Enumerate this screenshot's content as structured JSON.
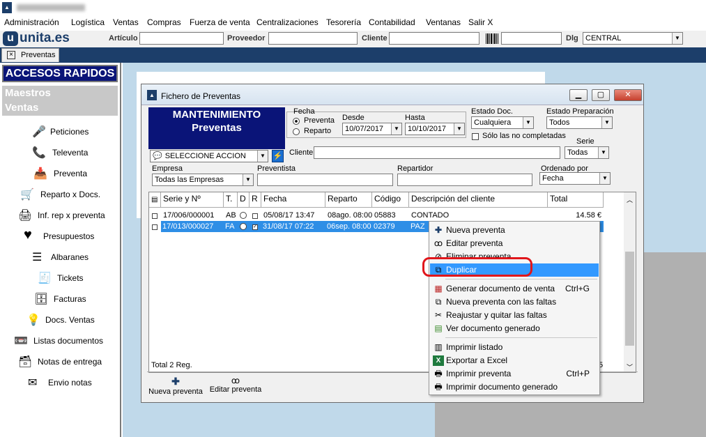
{
  "menu": [
    "Administración",
    "Logística",
    "Ventas",
    "Compras",
    "Fuerza de venta",
    "Centralizaciones",
    "Tesorería",
    "Contabilidad",
    "Ventanas",
    "Salir X"
  ],
  "logo": "unita.es",
  "toolbar": {
    "articulo": "Artículo",
    "proveedor": "Proveedor",
    "cliente": "Cliente",
    "dlg": "Dlg",
    "dlg_value": "CENTRAL"
  },
  "tab": "Preventas",
  "sidebar": {
    "title": "ACCESOS RAPIDOS",
    "maestros": "Maestros",
    "ventas": "Ventas",
    "items": [
      "Peticiones",
      "Televenta",
      "Preventa",
      "Reparto x Docs.",
      "Inf. rep x preventa",
      "Presupuestos",
      "Albaranes",
      "Tickets",
      "Facturas",
      "Docs. Ventas",
      "Listas documentos",
      "Notas de entrega",
      "Envio notas"
    ]
  },
  "window": {
    "title": "Fichero de Preventas",
    "heading1": "MANTENIMIENTO",
    "heading2": "Preventas",
    "fecha": "Fecha",
    "radio1": "Preventa",
    "radio2": "Reparto",
    "desde": "Desde",
    "desde_val": "10/07/2017",
    "hasta": "Hasta",
    "hasta_val": "10/10/2017",
    "estado_doc": "Estado Doc.",
    "estado_doc_val": "Cualquiera",
    "estado_prep": "Estado Preparación",
    "estado_prep_val": "Todos",
    "solo": "Sólo las no completadas",
    "serie": "Serie",
    "serie_val": "Todas",
    "accion": "SELECCIONE ACCION",
    "cliente": "Cliente",
    "empresa": "Empresa",
    "empresa_val": "Todas las Empresas",
    "preventista": "Preventista",
    "repartidor": "Repartidor",
    "ordenado": "Ordenado por",
    "ordenado_val": "Fecha",
    "total_reg": "Total 2 Reg.",
    "total_frag": "5",
    "btn_nueva": "Nueva preventa",
    "btn_editar": "Editar preventa"
  },
  "grid": {
    "headers": [
      "Serie y Nº",
      "T.",
      "D",
      "R",
      "Fecha",
      "Reparto",
      "Código",
      "Descripción del cliente",
      "Total"
    ],
    "rows": [
      {
        "serie": "17/006/000001",
        "t": "AB",
        "fecha": "05/08/17 13:47",
        "reparto": "08ago. 08:00",
        "codigo": "05883",
        "desc": "CONTADO",
        "total": "14.58 €"
      },
      {
        "serie": "17/013/000027",
        "t": "FA",
        "fecha": "31/08/17 07:22",
        "reparto": "06sep. 08:00",
        "codigo": "02379",
        "desc": "PAZ",
        "total": ""
      }
    ]
  },
  "context_menu": [
    {
      "label": "Nueva preventa",
      "shortcut": "",
      "icon": "plus-icon"
    },
    {
      "label": "Editar preventa",
      "shortcut": "",
      "icon": "glasses-icon"
    },
    {
      "label": "Eliminar preventa",
      "shortcut": "",
      "icon": "delete-icon"
    },
    {
      "label": "Duplicar",
      "shortcut": "",
      "icon": "duplicate-icon"
    },
    {
      "label": "Generar documento de venta",
      "shortcut": "Ctrl+G",
      "icon": "generate-doc-icon"
    },
    {
      "label": "Nueva preventa con las faltas",
      "shortcut": "",
      "icon": "new-missing-icon"
    },
    {
      "label": "Reajustar y quitar las faltas",
      "shortcut": "",
      "icon": "scissors-icon"
    },
    {
      "label": "Ver documento generado",
      "shortcut": "",
      "icon": "view-doc-icon"
    },
    {
      "label": "Imprimir listado",
      "shortcut": "",
      "icon": "print-list-icon"
    },
    {
      "label": "Exportar a Excel",
      "shortcut": "",
      "icon": "excel-icon"
    },
    {
      "label": "Imprimir preventa",
      "shortcut": "Ctrl+P",
      "icon": "printer-icon"
    },
    {
      "label": "Imprimir documento generado",
      "shortcut": "",
      "icon": "printer-doc-icon"
    }
  ]
}
